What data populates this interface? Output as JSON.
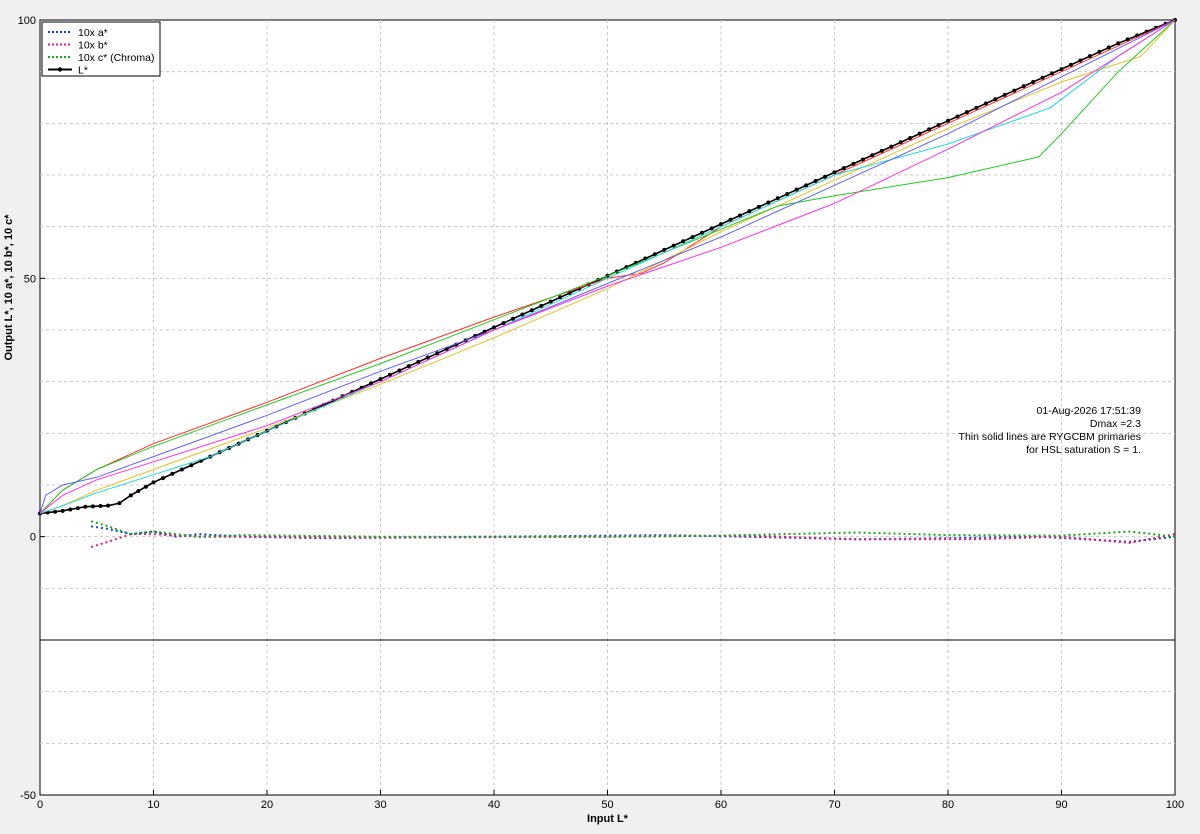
{
  "colors": {
    "background": "#f0f0f0",
    "plot_bg": "#ffffff",
    "grid": "#c8c8c8",
    "a_star": "#1f3fd8",
    "b_star": "#e0207a",
    "c_star": "#18a818",
    "L_star": "#000000",
    "red": "#ff2a2a",
    "yellow": "#e8c020",
    "green": "#22cc22",
    "cyan": "#22d8d8",
    "blue": "#6060ff",
    "magenta": "#ff30e0"
  },
  "chart_data": {
    "type": "line",
    "title": "",
    "xlabel": "Input L*",
    "ylabel": "Output L*, 10 a*, 10 b*, 10 c*",
    "xlim": [
      0,
      100
    ],
    "ylim": [
      -50,
      100
    ],
    "x_ticks": [
      "0",
      "10",
      "20",
      "30",
      "40",
      "50",
      "60",
      "70",
      "80",
      "90",
      "100"
    ],
    "y_ticks": [
      "-50",
      "0",
      "50",
      "100"
    ],
    "grid": true,
    "legend_position": "top-left",
    "legend": [
      {
        "label": "10x a*",
        "style": "dotted",
        "color_key": "a_star"
      },
      {
        "label": "10x b*",
        "style": "dotted",
        "color_key": "b_star"
      },
      {
        "label": "10x c* (Chroma)",
        "style": "dotted",
        "color_key": "c_star"
      },
      {
        "label": "L*",
        "style": "solid-marker",
        "color_key": "L_star"
      }
    ],
    "annotation": [
      "01-Aug-2026 17:51:39",
      "Dmax =2.3",
      "Thin solid lines are RYGCBM primaries",
      "for HSL saturation S = 1."
    ],
    "series": [
      {
        "name": "L*",
        "color_key": "L_star",
        "style": "marker",
        "points": [
          [
            0,
            4.5
          ],
          [
            2,
            5
          ],
          [
            4,
            5.8
          ],
          [
            6,
            6
          ],
          [
            7,
            6.5
          ],
          [
            8,
            8
          ],
          [
            10,
            10.5
          ],
          [
            15,
            15.5
          ],
          [
            20,
            20.5
          ],
          [
            25,
            25.5
          ],
          [
            30,
            30.5
          ],
          [
            35,
            35.5
          ],
          [
            40,
            40.5
          ],
          [
            45,
            45.5
          ],
          [
            50,
            50.5
          ],
          [
            55,
            55.5
          ],
          [
            60,
            60.5
          ],
          [
            65,
            65.5
          ],
          [
            70,
            70.5
          ],
          [
            75,
            75.5
          ],
          [
            80,
            80.5
          ],
          [
            85,
            85.5
          ],
          [
            90,
            90.5
          ],
          [
            95,
            95.5
          ],
          [
            100,
            100
          ]
        ]
      },
      {
        "color_key": "red",
        "style": "thin",
        "points": [
          [
            0,
            4.5
          ],
          [
            2,
            9
          ],
          [
            5,
            13
          ],
          [
            10,
            18
          ],
          [
            20,
            26
          ],
          [
            30,
            34.5
          ],
          [
            40,
            42.5
          ],
          [
            50,
            50
          ],
          [
            53,
            51
          ],
          [
            55,
            53
          ],
          [
            60,
            60
          ],
          [
            70,
            70
          ],
          [
            80,
            80
          ],
          [
            90,
            90
          ],
          [
            100,
            100
          ]
        ]
      },
      {
        "color_key": "yellow",
        "style": "thin",
        "points": [
          [
            0,
            4.5
          ],
          [
            2,
            6
          ],
          [
            5,
            9
          ],
          [
            10,
            13
          ],
          [
            20,
            21
          ],
          [
            30,
            29.5
          ],
          [
            40,
            38.5
          ],
          [
            50,
            48
          ],
          [
            60,
            59
          ],
          [
            70,
            69
          ],
          [
            80,
            79
          ],
          [
            90,
            88
          ],
          [
            97,
            93
          ],
          [
            100,
            100
          ]
        ]
      },
      {
        "color_key": "green",
        "style": "thin",
        "points": [
          [
            0,
            4.5
          ],
          [
            2,
            9
          ],
          [
            5,
            13
          ],
          [
            10,
            17.5
          ],
          [
            20,
            25.5
          ],
          [
            30,
            33.5
          ],
          [
            40,
            42
          ],
          [
            50,
            50.5
          ],
          [
            60,
            59.5
          ],
          [
            65,
            64
          ],
          [
            70,
            66
          ],
          [
            80,
            69.5
          ],
          [
            88,
            73.5
          ],
          [
            90,
            78
          ],
          [
            95,
            90
          ],
          [
            100,
            100
          ]
        ]
      },
      {
        "color_key": "cyan",
        "style": "thin",
        "points": [
          [
            0,
            4.5
          ],
          [
            2,
            6
          ],
          [
            5,
            8.5
          ],
          [
            10,
            12
          ],
          [
            15,
            15.5
          ],
          [
            20,
            20.5
          ],
          [
            30,
            30
          ],
          [
            40,
            40
          ],
          [
            50,
            50
          ],
          [
            60,
            60
          ],
          [
            70,
            70
          ],
          [
            80,
            76
          ],
          [
            89,
            83
          ],
          [
            95,
            93
          ],
          [
            100,
            100
          ]
        ]
      },
      {
        "color_key": "blue",
        "style": "thin",
        "points": [
          [
            0,
            4.5
          ],
          [
            0.5,
            8
          ],
          [
            2,
            10
          ],
          [
            5,
            11.5
          ],
          [
            10,
            15.5
          ],
          [
            20,
            23.5
          ],
          [
            30,
            32
          ],
          [
            40,
            40
          ],
          [
            50,
            49
          ],
          [
            60,
            58
          ],
          [
            70,
            68
          ],
          [
            80,
            78
          ],
          [
            90,
            89
          ],
          [
            100,
            100
          ]
        ]
      },
      {
        "color_key": "magenta",
        "style": "thin",
        "points": [
          [
            0,
            4.5
          ],
          [
            2,
            8
          ],
          [
            5,
            11
          ],
          [
            10,
            14.5
          ],
          [
            20,
            21.5
          ],
          [
            30,
            30
          ],
          [
            40,
            40
          ],
          [
            50,
            48.5
          ],
          [
            60,
            56
          ],
          [
            70,
            64.5
          ],
          [
            80,
            75
          ],
          [
            90,
            86
          ],
          [
            100,
            100
          ]
        ]
      },
      {
        "name": "10x a*",
        "color_key": "a_star",
        "style": "dotted",
        "points": [
          [
            4.5,
            2
          ],
          [
            6,
            1.5
          ],
          [
            8,
            0.5
          ],
          [
            10,
            1
          ],
          [
            12,
            0
          ],
          [
            14,
            0.5
          ],
          [
            18,
            0
          ],
          [
            25,
            -0.3
          ],
          [
            40,
            0
          ],
          [
            55,
            0.3
          ],
          [
            62,
            0
          ],
          [
            72,
            -0.5
          ],
          [
            80,
            -0.3
          ],
          [
            88,
            0
          ],
          [
            96,
            -1
          ],
          [
            100,
            0
          ]
        ]
      },
      {
        "name": "10x b*",
        "color_key": "b_star",
        "style": "dotted",
        "points": [
          [
            4.5,
            -2
          ],
          [
            6,
            -1
          ],
          [
            8,
            0.5
          ],
          [
            10,
            0.5
          ],
          [
            14,
            0
          ],
          [
            20,
            0
          ],
          [
            30,
            -0.2
          ],
          [
            50,
            0
          ],
          [
            62,
            0.2
          ],
          [
            72,
            -0.5
          ],
          [
            82,
            -0.5
          ],
          [
            90,
            0
          ],
          [
            96,
            -1.2
          ],
          [
            100,
            0.5
          ]
        ]
      },
      {
        "name": "10x c* (Chroma)",
        "color_key": "c_star",
        "style": "dotted",
        "points": [
          [
            4.5,
            3
          ],
          [
            6,
            2
          ],
          [
            8,
            0.5
          ],
          [
            10,
            1
          ],
          [
            14,
            0
          ],
          [
            18,
            0.3
          ],
          [
            30,
            0
          ],
          [
            50,
            0
          ],
          [
            60,
            0.2
          ],
          [
            72,
            0.8
          ],
          [
            80,
            0.3
          ],
          [
            90,
            0.2
          ],
          [
            96,
            1
          ],
          [
            100,
            0
          ]
        ]
      }
    ]
  }
}
